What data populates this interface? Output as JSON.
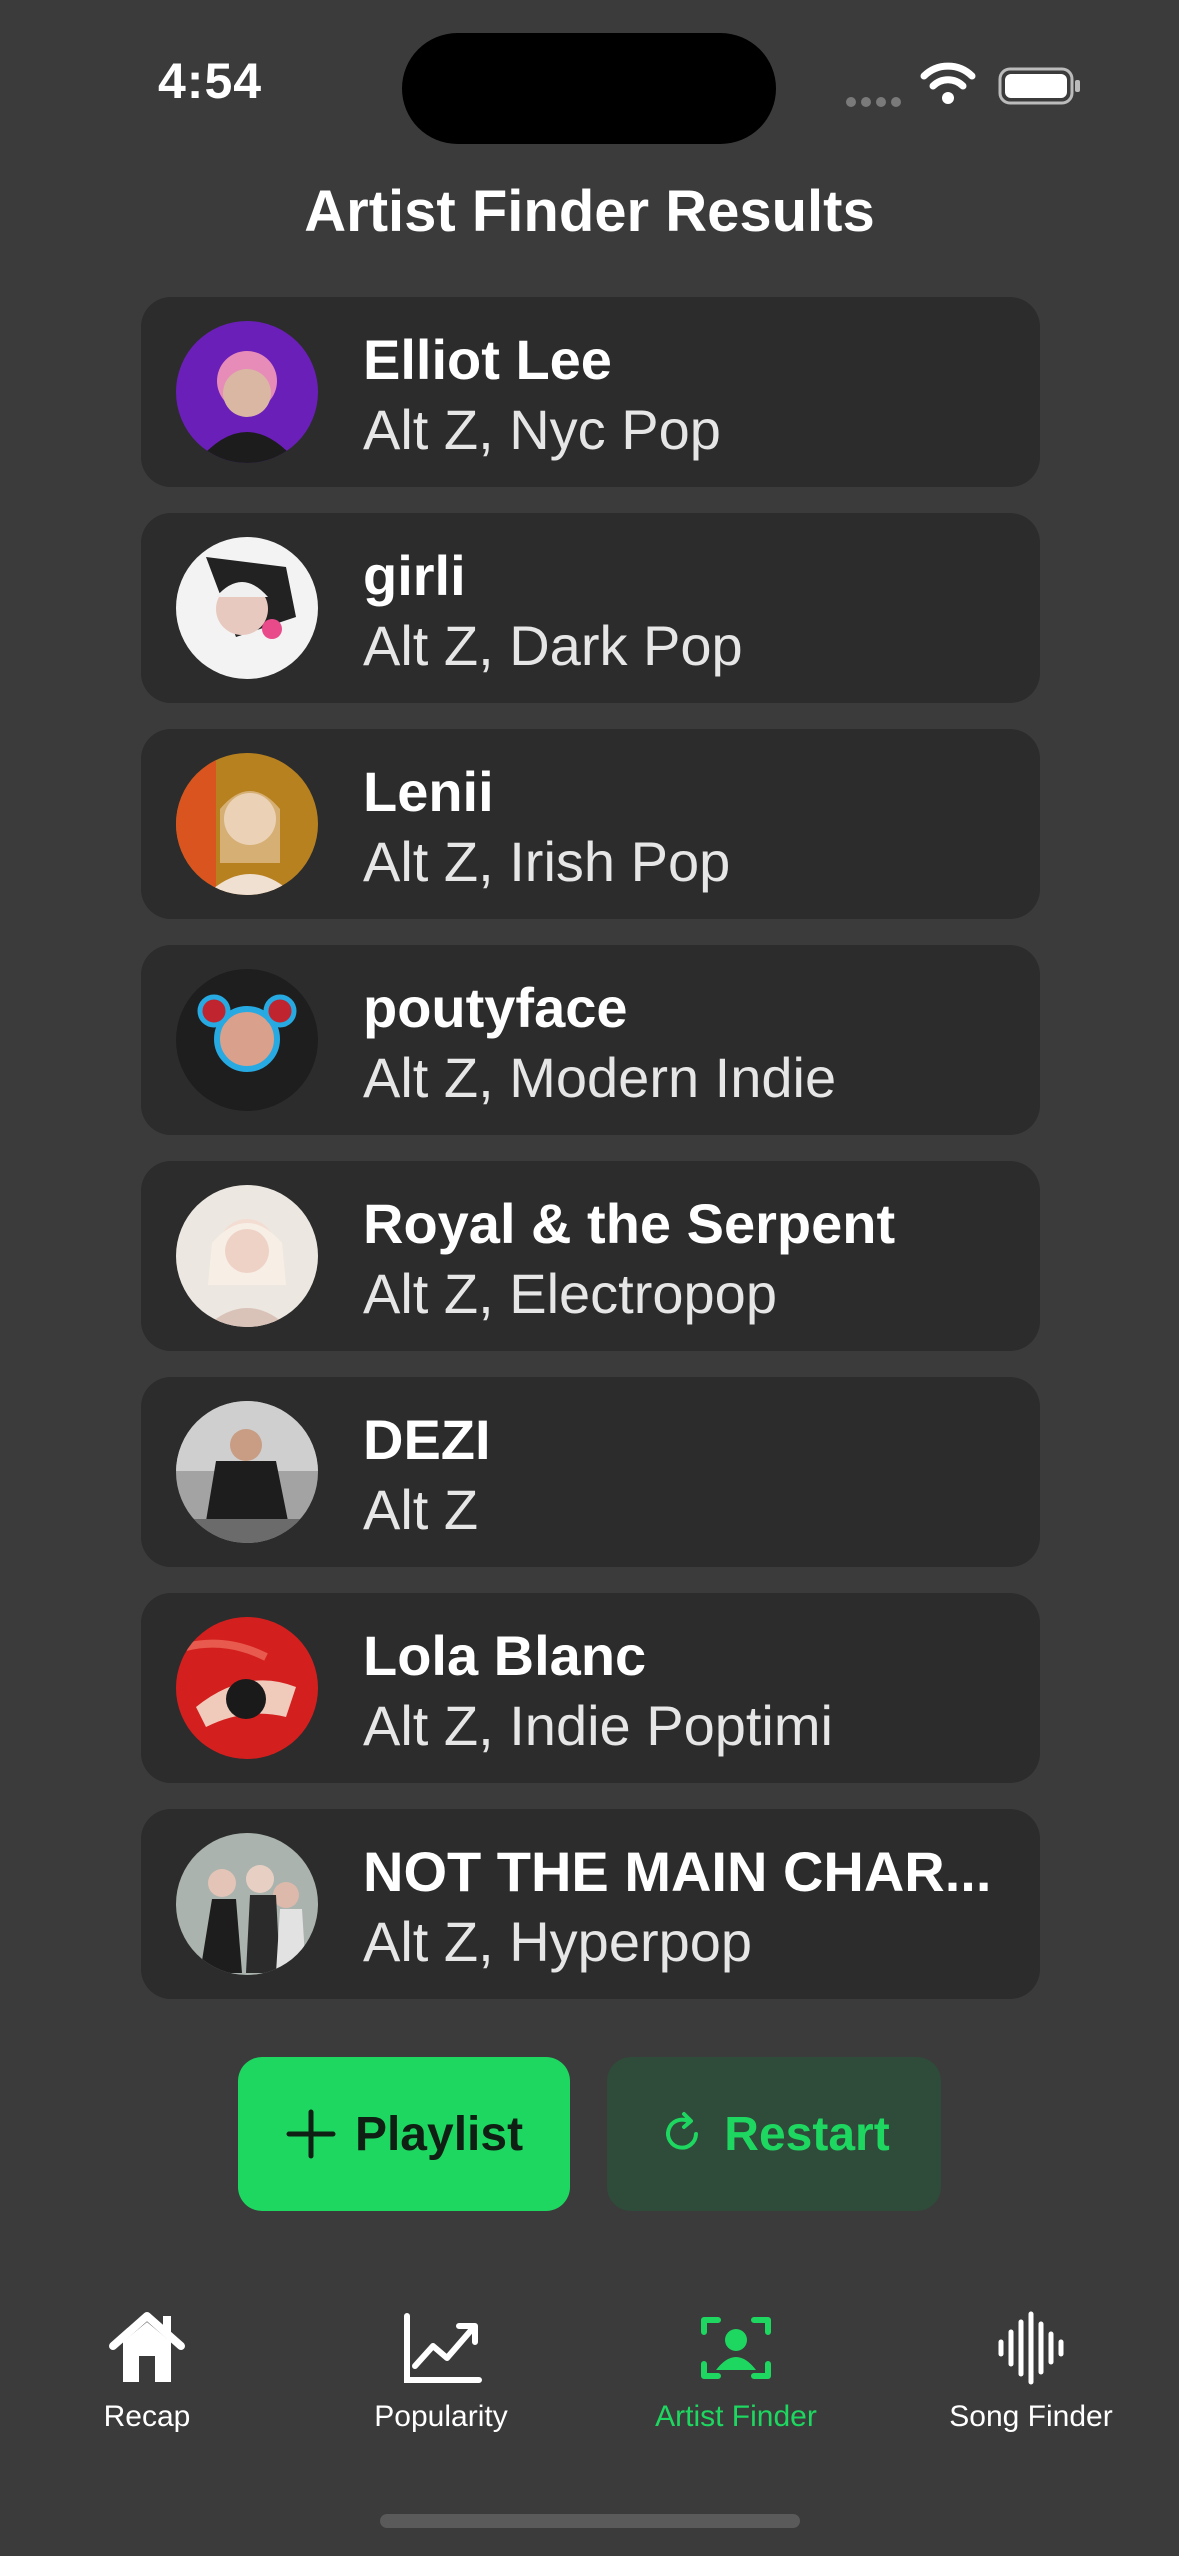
{
  "status_bar": {
    "time": "4:54"
  },
  "page_title": "Artist Finder Results",
  "artists": [
    {
      "name": "Elliot Lee",
      "genres": "Alt Z, Nyc Pop",
      "avatar_color": "#8a2be2"
    },
    {
      "name": "girli",
      "genres": "Alt Z, Dark Pop",
      "avatar_color": "#f2f2f2"
    },
    {
      "name": "Lenii",
      "genres": "Alt Z, Irish Pop",
      "avatar_color": "#c98a2a"
    },
    {
      "name": "poutyface",
      "genres": "Alt Z, Modern Indie",
      "avatar_color": "#202020"
    },
    {
      "name": "Royal & the Serpent",
      "genres": "Alt Z, Electropop",
      "avatar_color": "#e9e4de"
    },
    {
      "name": "DEZI",
      "genres": "Alt Z",
      "avatar_color": "#9a9a9a"
    },
    {
      "name": "Lola Blanc",
      "genres": "Alt Z, Indie Poptimi",
      "avatar_color": "#d3201f"
    },
    {
      "name": "NOT THE MAIN CHAR...",
      "genres": "Alt Z, Hyperpop",
      "avatar_color": "#8f9a92"
    }
  ],
  "buttons": {
    "playlist": "Playlist",
    "restart": "Restart"
  },
  "tabs": [
    {
      "label": "Recap",
      "icon": "house-icon",
      "active": false
    },
    {
      "label": "Popularity",
      "icon": "chart-icon",
      "active": false
    },
    {
      "label": "Artist Finder",
      "icon": "person-viewfinder-icon",
      "active": true
    },
    {
      "label": "Song Finder",
      "icon": "waveform-icon",
      "active": false
    }
  ],
  "colors": {
    "accent": "#1ed760",
    "card": "#2c2c2c",
    "background": "#3b3b3b"
  }
}
